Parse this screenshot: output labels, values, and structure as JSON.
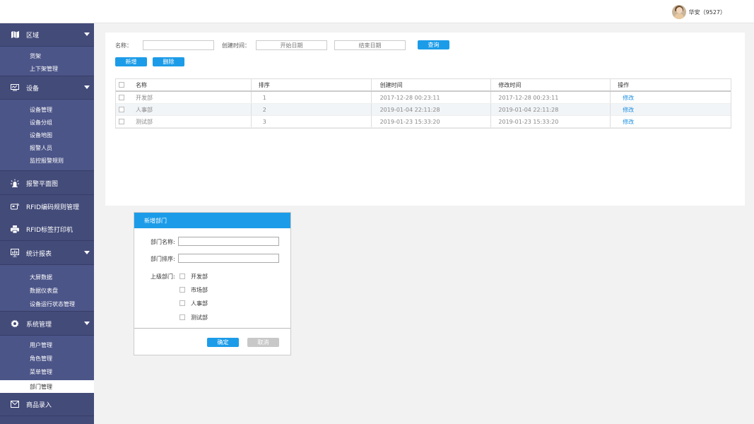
{
  "header": {
    "user_name": "华安（9527）"
  },
  "sidebar": {
    "groups": [
      {
        "label": "区域",
        "icon": "map-icon",
        "subitems": [
          "货架",
          "上下架管理"
        ]
      },
      {
        "label": "设备",
        "icon": "monitor-icon",
        "subitems": [
          "设备管理",
          "设备分组",
          "设备地图",
          "报警人员",
          "监控报警规则"
        ]
      },
      {
        "label": "报警平面图",
        "icon": "alarm-light-icon",
        "subitems": []
      },
      {
        "label": "RFID编码规则管理",
        "icon": "rfid-icon",
        "subitems": []
      },
      {
        "label": "RFID标签打印机",
        "icon": "printer-icon",
        "subitems": []
      },
      {
        "label": "统计报表",
        "icon": "report-icon",
        "subitems": [
          "大屏数据",
          "数据仪表盘",
          "设备运行状态管理"
        ]
      },
      {
        "label": "系统管理",
        "icon": "gear-icon",
        "subitems": [
          "用户管理",
          "角色管理",
          "菜单管理",
          "部门管理"
        ]
      },
      {
        "label": "商品录入",
        "icon": "mail-icon",
        "subitems": []
      }
    ],
    "active_item": "部门管理"
  },
  "filters": {
    "name_label": "名称：",
    "name_value": "",
    "time_label": "创建时间：",
    "start_placeholder": "开始日期",
    "end_placeholder": "结束日期",
    "query_label": "查询"
  },
  "actions": {
    "add_label": "新增",
    "delete_label": "删除"
  },
  "table": {
    "columns": [
      "名称",
      "排序",
      "创建时间",
      "修改时间",
      "操作"
    ],
    "rows": [
      {
        "name": "开发部",
        "sort": "1",
        "created": "2017-12-28 00:23:11",
        "modified": "2017-12-28 00:23:11",
        "op": "修改"
      },
      {
        "name": "人事部",
        "sort": "2",
        "created": "2019-01-04 22:11:28",
        "modified": "2019-01-04 22:11:28",
        "op": "修改"
      },
      {
        "name": "测试部",
        "sort": "3",
        "created": "2019-01-23 15:33:20",
        "modified": "2019-01-23 15:33:20",
        "op": "修改"
      }
    ]
  },
  "dialog": {
    "title": "新增部门",
    "name_label": "部门名称:",
    "sort_label": "部门排序:",
    "parent_label": "上级部门:",
    "parent_options": [
      "开发部",
      "市场部",
      "人事部",
      "测试部"
    ],
    "confirm_label": "确定",
    "cancel_label": "取消"
  },
  "colors": {
    "sidebar_bg": "#434b79",
    "accent": "#1c9ce8"
  }
}
